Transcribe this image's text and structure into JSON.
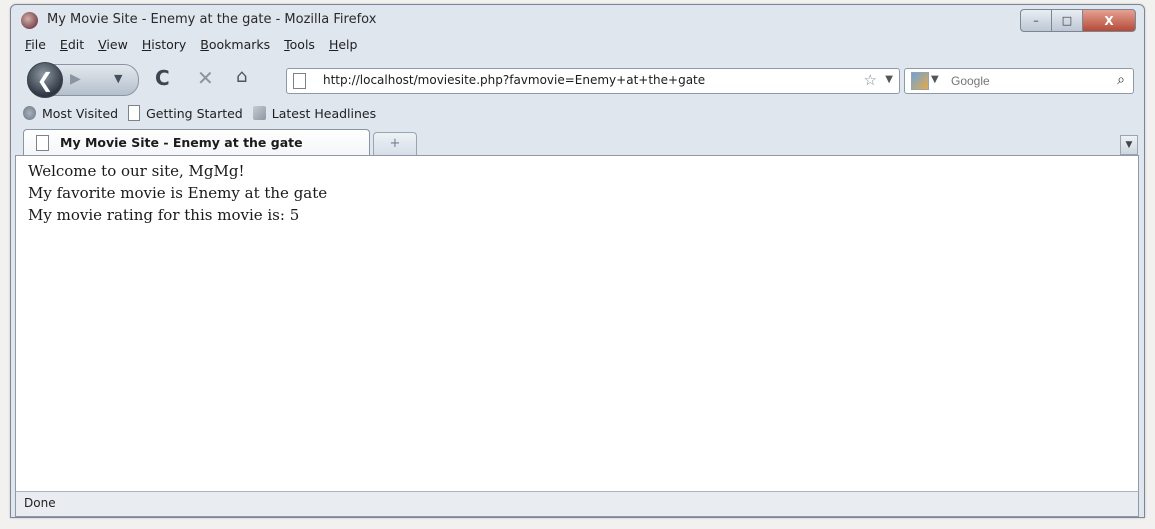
{
  "window": {
    "title": "My Movie Site - Enemy at the gate - Mozilla Firefox",
    "controls": {
      "minimize": "–",
      "maximize": "□",
      "close": "X"
    }
  },
  "menu": {
    "items": [
      "File",
      "Edit",
      "View",
      "History",
      "Bookmarks",
      "Tools",
      "Help"
    ]
  },
  "navigation": {
    "url": "http://localhost/moviesite.php?favmovie=Enemy+at+the+gate",
    "search_placeholder": "Google",
    "icons": [
      "back-icon",
      "forward-icon",
      "reload-icon",
      "stop-icon",
      "home-icon",
      "star-icon",
      "search-icon"
    ]
  },
  "bookmarks": {
    "items": [
      "Most Visited",
      "Getting Started",
      "Latest Headlines"
    ]
  },
  "tabs": {
    "active": "My Movie Site - Enemy at the gate",
    "new_tab": "+"
  },
  "page": {
    "lines": [
      "Welcome to our site, MgMg!",
      "My favorite movie is Enemy at the gate",
      "My movie rating for this movie is: 5"
    ]
  },
  "status": {
    "text": "Done"
  }
}
